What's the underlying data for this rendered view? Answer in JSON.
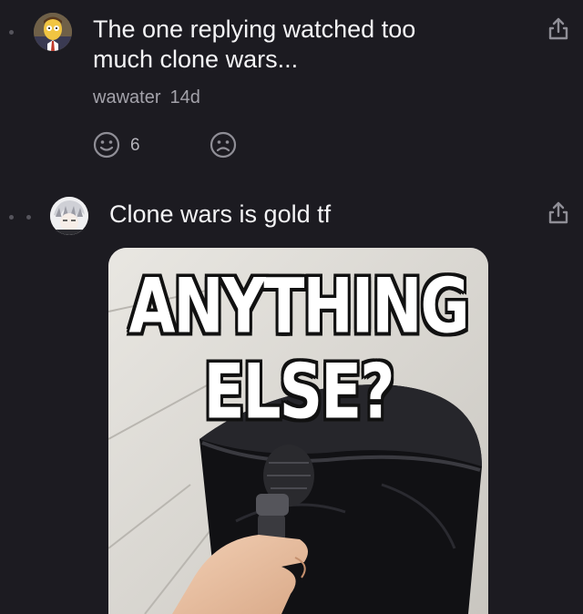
{
  "comments": [
    {
      "text": "The one replying watched too\nmuch clone wars...",
      "author": "wawater",
      "time": "14d",
      "upvotes": "6",
      "avatar_icon": "cartoon-businessman-avatar",
      "share_icon": "share-icon"
    },
    {
      "text": "Clone wars is gold tf",
      "avatar_icon": "anime-character-avatar",
      "share_icon": "share-icon",
      "image": {
        "caption_line1": "ANYTHING",
        "caption_line2": "ELSE?"
      }
    }
  ],
  "colors": {
    "background": "#1c1b21",
    "text": "#f4f4f6",
    "meta": "#a3a2aa",
    "icon": "#8f8e96"
  }
}
